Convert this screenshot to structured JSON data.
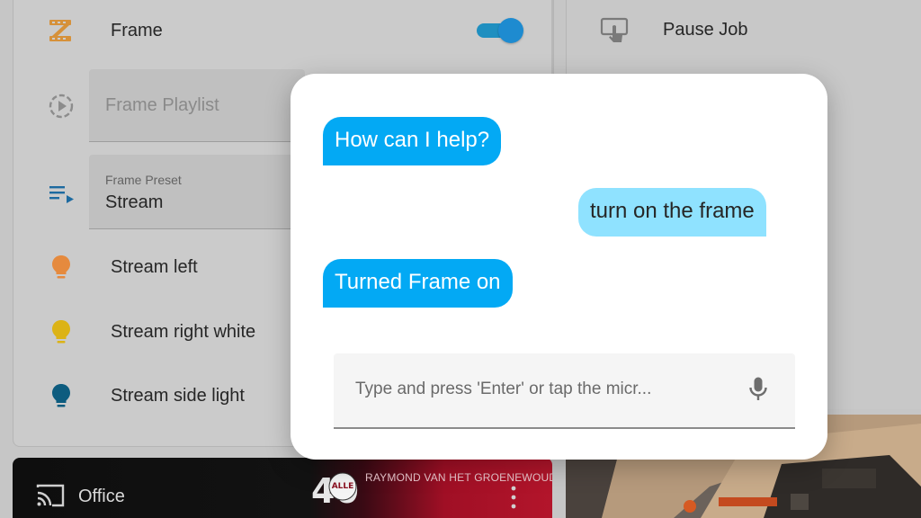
{
  "left_panel": {
    "rows": [
      {
        "label": "Frame",
        "icon": "filmstrip-icon",
        "toggle_on": true
      },
      {
        "placeholder": "Frame Playlist",
        "icon": "play-circle-icon"
      },
      {
        "caption": "Frame Preset",
        "value": "Stream",
        "icon": "playlist-icon"
      },
      {
        "label": "Stream left",
        "icon": "lightbulb-icon",
        "color": "#e58a3e"
      },
      {
        "label": "Stream right white",
        "icon": "lightbulb-icon",
        "color": "#dcb316"
      },
      {
        "label": "Stream side light",
        "icon": "lightbulb-icon",
        "color": "#0d5c7f"
      }
    ]
  },
  "right_panel": {
    "pause_label": "Pause Job",
    "pause_icon": "touch-icon"
  },
  "media": {
    "title": "Office",
    "artist": "RAYMOND VAN HET GROENEWOUD",
    "cast_icon": "cast-icon",
    "more_icon": "more-vertical-icon",
    "badge_text_line1": "ALLE",
    "badge_text_line2": "40"
  },
  "dialog": {
    "messages": [
      {
        "from": "assistant",
        "text": "How can I help?"
      },
      {
        "from": "user",
        "text": "turn on the frame"
      },
      {
        "from": "assistant",
        "text": "Turned Frame on"
      }
    ],
    "input_placeholder": "Type and press 'Enter' or tap the micr...",
    "mic_icon": "microphone-icon"
  },
  "colors": {
    "assistant_bubble": "#03a9f4",
    "user_bubble": "#8fe2ff",
    "accent": "#1e8bd0"
  }
}
